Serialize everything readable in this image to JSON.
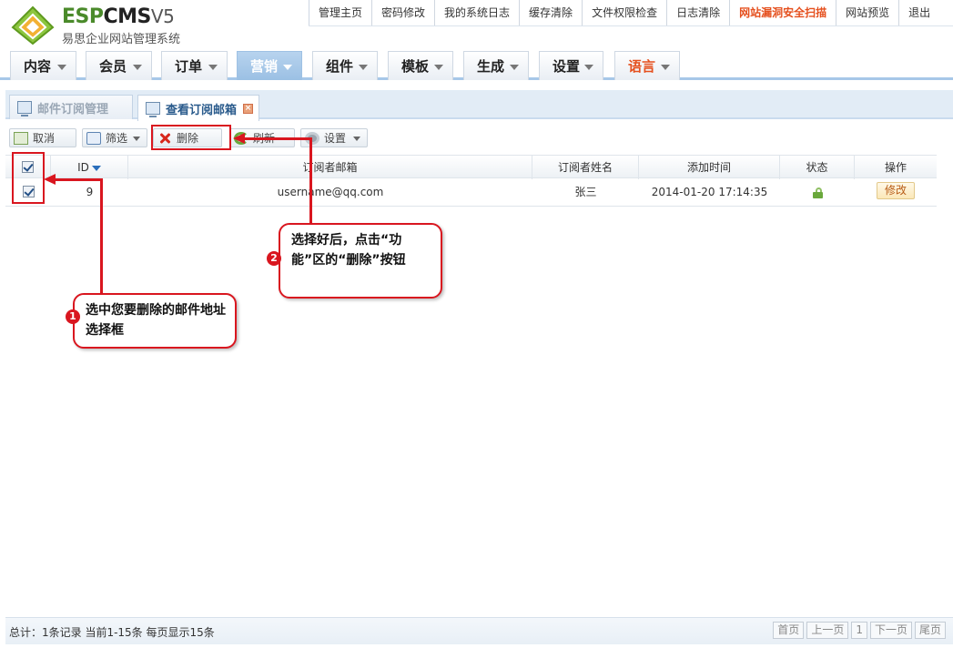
{
  "brand": {
    "name_green": "ESP",
    "name_dark": "CMS",
    "version": "V5",
    "subtitle": "易思企业网站管理系统"
  },
  "top_links": [
    {
      "label": "管理主页"
    },
    {
      "label": "密码修改"
    },
    {
      "label": "我的系统日志"
    },
    {
      "label": "缓存清除"
    },
    {
      "label": "文件权限检查"
    },
    {
      "label": "日志清除"
    },
    {
      "label": "网站漏洞安全扫描"
    },
    {
      "label": "网站预览"
    },
    {
      "label": "退出"
    }
  ],
  "nav_tabs": [
    {
      "label": "内容"
    },
    {
      "label": "会员"
    },
    {
      "label": "订单"
    },
    {
      "label": "营销"
    },
    {
      "label": "组件"
    },
    {
      "label": "模板"
    },
    {
      "label": "生成"
    },
    {
      "label": "设置"
    },
    {
      "label": "语言"
    }
  ],
  "sub_tabs": [
    {
      "label": "邮件订阅管理"
    },
    {
      "label": "查看订阅邮箱"
    }
  ],
  "toolbar": {
    "cancel": "取消",
    "filter": "筛选",
    "delete": "删除",
    "refresh": "刷新",
    "settings": "设置"
  },
  "table": {
    "headers": {
      "id": "ID",
      "email": "订阅者邮箱",
      "name": "订阅者姓名",
      "added": "添加时间",
      "status": "状态",
      "action": "操作"
    },
    "rows": [
      {
        "id": "9",
        "email": "username@qq.com",
        "name": "张三",
        "added": "2014-01-20 17:14:35",
        "status": "unlocked",
        "action": "修改"
      }
    ]
  },
  "callouts": {
    "step1": {
      "num": "1",
      "text": "选中您要删除的邮件地址选择框"
    },
    "step2": {
      "num": "2",
      "text": "选择好后，点击“功能”区的“删除”按钮"
    }
  },
  "footer": {
    "summary": "总计：1条记录 当前1-15条 每页显示15条",
    "pager": {
      "first": "首页",
      "prev": "上一页",
      "page": "1",
      "next": "下一页",
      "last": "尾页"
    }
  },
  "colors": {
    "accent_red": "#d9161f",
    "nav_active": "#a7c7e8",
    "alert_orange": "#e5501e"
  },
  "icons": {
    "close_icon": "close-icon",
    "sort_icon": "sort-desc-icon",
    "lock_icon": "unlocked-icon"
  }
}
